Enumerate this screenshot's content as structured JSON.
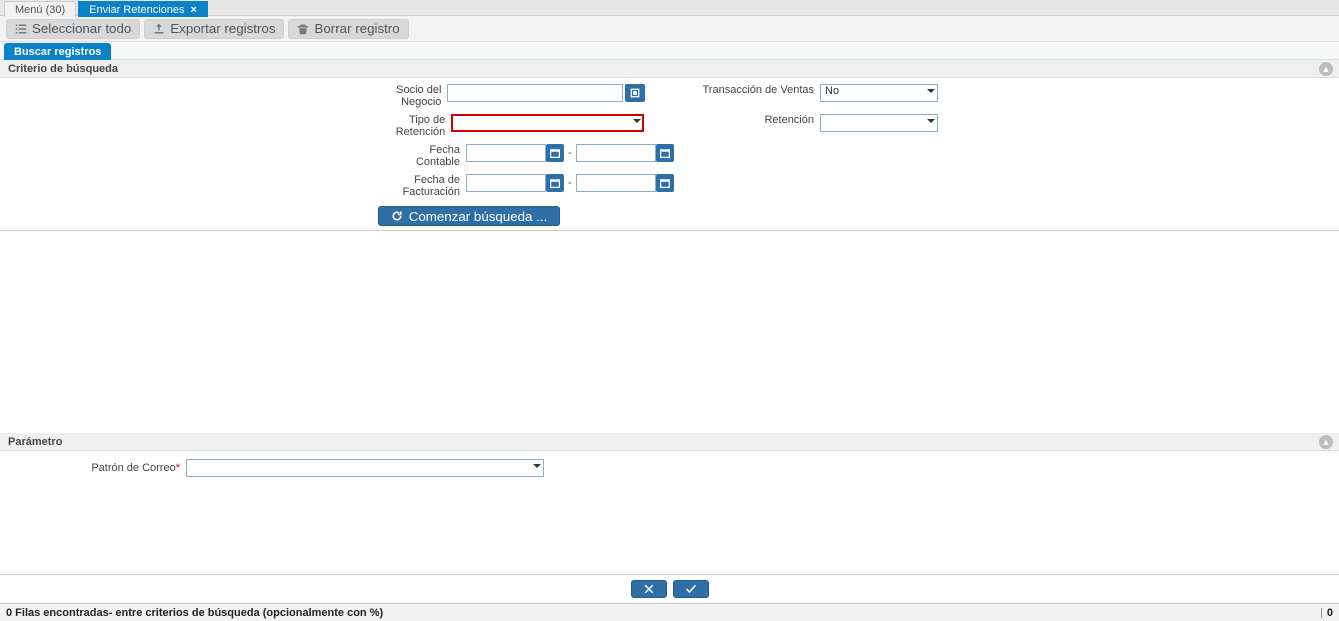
{
  "tabs": {
    "menu_label": "Menú (30)",
    "active_label": "Enviar Retenciones"
  },
  "toolbar": {
    "select_all": "Seleccionar todo",
    "export": "Exportar registros",
    "delete": "Borrar registro"
  },
  "subtab": {
    "search_records": "Buscar registros"
  },
  "sections": {
    "criteria_title": "Criterio de búsqueda",
    "param_title": "Parámetro"
  },
  "form": {
    "bp_label1": "Socio del",
    "bp_label2": "Negocio",
    "bp_value": "",
    "ret_type_label1": "Tipo de",
    "ret_type_label2": "Retención",
    "ret_type_value": "",
    "acct_date_label1": "Fecha",
    "acct_date_label2": "Contable",
    "acct_date_from": "",
    "acct_date_to": "",
    "inv_date_label1": "Fecha de",
    "inv_date_label2": "Facturación",
    "inv_date_from": "",
    "inv_date_to": "",
    "sales_trx_label": "Transacción de Ventas",
    "sales_trx_value": "No",
    "retention_label": "Retención",
    "retention_value": "",
    "begin_search": "Comenzar búsqueda ..."
  },
  "param": {
    "mail_pattern_label": "Patrón de Correo",
    "mail_pattern_value": ""
  },
  "status": {
    "rows_text": "0 Filas encontradas- entre criterios de búsqueda (opcionalmente con %)",
    "count": "0"
  }
}
